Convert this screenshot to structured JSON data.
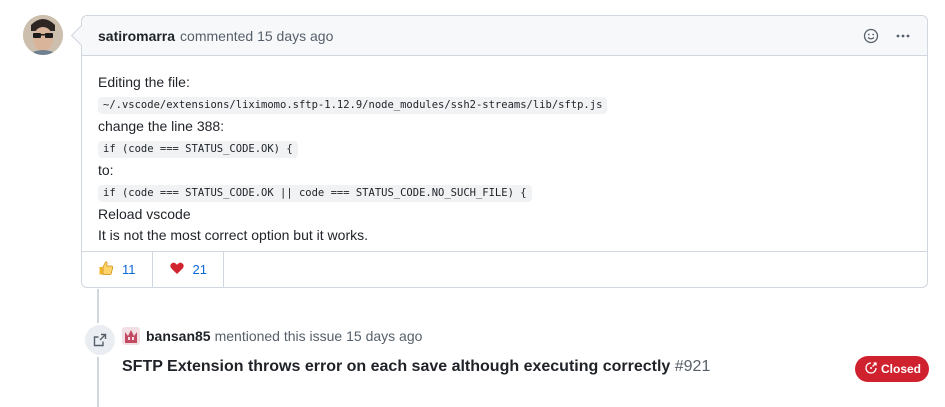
{
  "comment": {
    "author": "satiromarra",
    "action": "commented 15 days ago",
    "body": {
      "line1": "Editing the file:",
      "code1": "~/.vscode/extensions/liximomo.sftp-1.12.9/node_modules/ssh2-streams/lib/sftp.js",
      "line2": "change the line 388:",
      "code2": "if (code === STATUS_CODE.OK) {",
      "line3": "to:",
      "code3": "if (code === STATUS_CODE.OK || code === STATUS_CODE.NO_SUCH_FILE) {",
      "line4": "Reload vscode",
      "line5": "It is not the most correct option but it works."
    },
    "reactions": [
      {
        "icon": "thumbs-up-icon",
        "count": "11"
      },
      {
        "icon": "heart-icon",
        "count": "21"
      }
    ]
  },
  "mention": {
    "author": "bansan85",
    "action": "mentioned this issue 15 days ago",
    "issue_title": "SFTP Extension throws error on each save although executing correctly",
    "issue_number": "#921",
    "status": "Closed",
    "status_color": "#cf222e"
  }
}
